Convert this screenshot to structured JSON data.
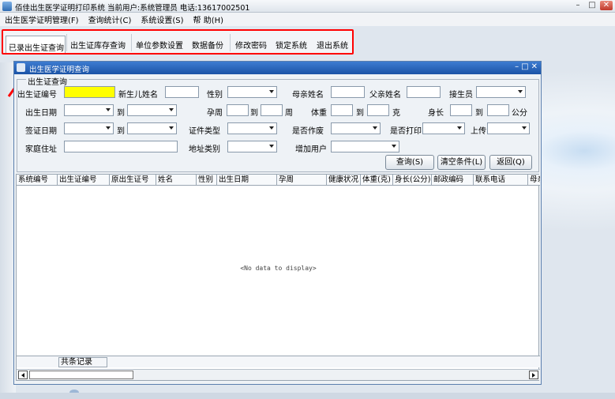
{
  "app": {
    "title": "佰佳出生医学证明打印系统 当前用户:系统管理员  电话:13617002501",
    "minimize": "–",
    "maximize": "□",
    "close": "✕"
  },
  "menu": [
    "出生医学证明管理(F)",
    "查询统计(C)",
    "系统设置(S)",
    "帮 助(H)"
  ],
  "toolbar": {
    "items": [
      "已录出生证查询",
      "出生证库存查询",
      "单位参数设置",
      "数据备份",
      "修改密码",
      "锁定系统",
      "退出系统"
    ],
    "highlight_color": "#ff0000"
  },
  "window": {
    "title": "出生医学证明查询",
    "controls": {
      "min": "–",
      "max": "□",
      "close": "✕"
    }
  },
  "form": {
    "group_label": "出生证查询",
    "labels": {
      "cert_no": "出生证编号",
      "baby_name": "新生儿姓名",
      "sex": "性别",
      "mother_name": "母亲姓名",
      "father_name": "父亲姓名",
      "deliverer": "接生员",
      "birth_date": "出生日期",
      "to1": "到",
      "gestation": "孕周",
      "to2": "到",
      "week": "周",
      "weight": "体重",
      "to3": "到",
      "gram": "克",
      "height": "身长",
      "to4": "到",
      "cm": "公分",
      "issue_date": "签证日期",
      "to5": "到",
      "id_type": "证件类型",
      "voided": "是否作废",
      "printed": "是否打印",
      "uploaded": "上传",
      "address": "家庭住址",
      "address_type": "地址类别",
      "added_user": "增加用户"
    },
    "buttons": {
      "query": "查询(S)",
      "clear": "清空条件(L)",
      "back": "返回(Q)"
    },
    "highlight_field_color": "#ffff00"
  },
  "grid": {
    "columns": [
      "系统编号",
      "出生证编号",
      "原出生证号",
      "姓名",
      "性别",
      "出生日期",
      "孕周",
      "健康状况",
      "体重(克)",
      "身长(公分)",
      "邮政编码",
      "联系电话",
      "母亲"
    ],
    "empty_text": "<No data to display>",
    "footer_label": "共条记录"
  }
}
